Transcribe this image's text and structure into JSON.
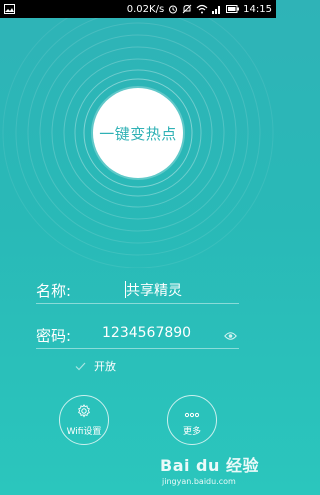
{
  "statusbar": {
    "speed": "0.02K/s",
    "time": "14:15",
    "icons": [
      "image-notification-icon",
      "alarm-icon",
      "mute-icon",
      "wifi-icon",
      "signal-icon",
      "battery-icon"
    ]
  },
  "main": {
    "hotspot_button_label": "一键变热点",
    "name_label": "名称:",
    "name_value": "共享精灵",
    "password_label": "密码:",
    "password_value": "1234567890",
    "open_label": "开放",
    "open_checked": true
  },
  "bottom": {
    "wifi_settings_label": "Wifi设置",
    "more_label": "更多"
  },
  "watermark": {
    "brand": "Bai du 经验",
    "url": "jingyan.baidu.com"
  },
  "colors": {
    "background_top": "#2fb3b7",
    "background_bottom": "#2bc6bd",
    "accent": "#2fb1b5",
    "statusbar": "#000000"
  }
}
